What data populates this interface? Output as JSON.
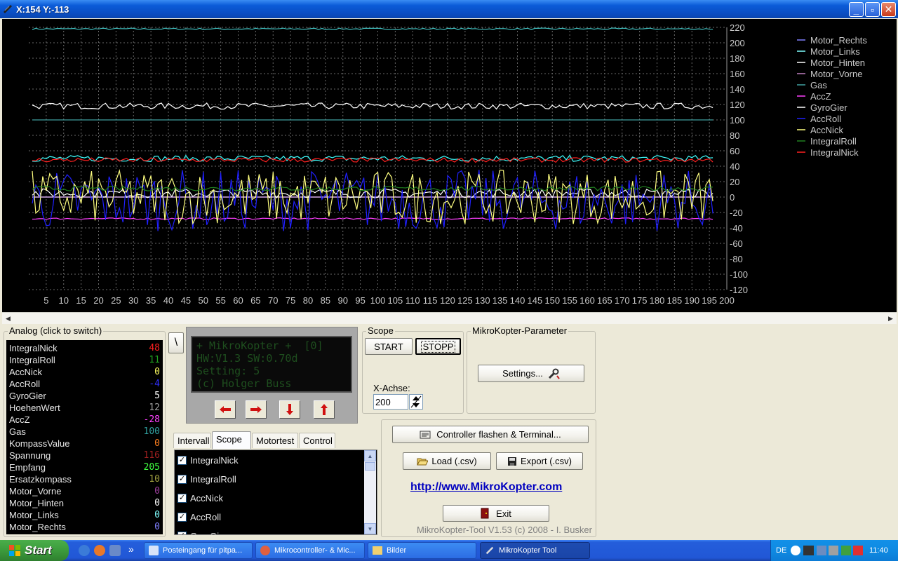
{
  "window": {
    "title": "X:154  Y:-113",
    "buttons": {
      "minimize": "_",
      "maximize": "▫",
      "close": "✕"
    }
  },
  "chart_data": {
    "type": "line",
    "background": "#000000",
    "grid": true,
    "xlim": [
      0,
      200
    ],
    "ylim": [
      -120,
      220
    ],
    "x_ticks": [
      5,
      10,
      15,
      20,
      25,
      30,
      35,
      40,
      45,
      50,
      55,
      60,
      65,
      70,
      75,
      80,
      85,
      90,
      95,
      100,
      105,
      110,
      115,
      120,
      125,
      130,
      135,
      140,
      145,
      150,
      155,
      160,
      165,
      170,
      175,
      180,
      185,
      190,
      195,
      200
    ],
    "y_ticks": [
      220,
      200,
      180,
      160,
      140,
      120,
      100,
      80,
      60,
      40,
      20,
      0,
      -20,
      -40,
      -60,
      -80,
      -100,
      -120
    ],
    "legend_position": "top-right",
    "series": [
      {
        "name": "Motor_Rechts",
        "color": "#8080FF",
        "level": 0,
        "noise": 0
      },
      {
        "name": "Motor_Links",
        "color": "#80FFFF",
        "level": 0,
        "noise": 0
      },
      {
        "name": "Motor_Hinten",
        "color": "#FFFFFF",
        "level": 0,
        "noise": 0
      },
      {
        "name": "Motor_Vorne",
        "color": "#C080C0",
        "level": 0,
        "noise": 0
      },
      {
        "name": "Gas",
        "color": "#40A0A0",
        "level": 100,
        "noise": 0
      },
      {
        "name": "AccZ",
        "color": "#FF40FF",
        "level": -28,
        "noise": 1
      },
      {
        "name": "GyroGier",
        "color": "#FFFFFF",
        "level": 5,
        "noise": 6
      },
      {
        "name": "AccRoll",
        "color": "#2020FF",
        "level": -4,
        "noise": 40
      },
      {
        "name": "AccNick",
        "color": "#FFFF80",
        "level": 0,
        "noise": 35
      },
      {
        "name": "IntegralRoll",
        "color": "#208020",
        "level": 11,
        "noise": 3
      },
      {
        "name": "IntegralNick",
        "color": "#FF2020",
        "level": 48,
        "noise": 3
      }
    ],
    "extra_series": [
      {
        "name": "",
        "color": "#40C0C0",
        "level": 218,
        "noise": 1
      },
      {
        "name": "",
        "color": "#FFFFFF",
        "level": 118,
        "noise": 4
      },
      {
        "name": "",
        "color": "#40FFFF",
        "level": 50,
        "noise": 4
      }
    ]
  },
  "analog": {
    "label": "Analog (click to switch)",
    "rows": [
      {
        "name": "IntegralNick",
        "value": "48",
        "color": "#FF2020"
      },
      {
        "name": "IntegralRoll",
        "value": "11",
        "color": "#20A020"
      },
      {
        "name": "AccNick",
        "value": "0",
        "color": "#FFFF60"
      },
      {
        "name": "AccRoll",
        "value": "-4",
        "color": "#3030FF"
      },
      {
        "name": "GyroGier",
        "value": "5",
        "color": "#FFFFFF"
      },
      {
        "name": "HoehenWert",
        "value": "12",
        "color": "#A0A0A0"
      },
      {
        "name": "AccZ",
        "value": "-28",
        "color": "#FF40FF"
      },
      {
        "name": "Gas",
        "value": "100",
        "color": "#30A0A0"
      },
      {
        "name": "KompassValue",
        "value": "0",
        "color": "#FF8020"
      },
      {
        "name": "Spannung",
        "value": "116",
        "color": "#A02020"
      },
      {
        "name": "Empfang",
        "value": "205",
        "color": "#40FF40"
      },
      {
        "name": "Ersatzkompass",
        "value": "10",
        "color": "#A0A040"
      },
      {
        "name": "Motor_Vorne",
        "value": "0",
        "color": "#A040A0"
      },
      {
        "name": "Motor_Hinten",
        "value": "0",
        "color": "#FFFFFF"
      },
      {
        "name": "Motor_Links",
        "value": "0",
        "color": "#80FFFF"
      },
      {
        "name": "Motor_Rechts",
        "value": "0",
        "color": "#8080FF"
      }
    ]
  },
  "side_button": "\\",
  "lcd": {
    "lines": [
      "+ MikroKopter +  [0]",
      "HW:V1.3 SW:0.70d",
      "Setting: 5",
      "(c) Holger Buss"
    ]
  },
  "scope": {
    "label": "Scope",
    "start": "START",
    "stopp": "STOPP",
    "x_achse_label": "X-Achse:",
    "x_achse_value": "200"
  },
  "params": {
    "label": "MikroKopter-Parameter",
    "settings": "Settings..."
  },
  "tabs": [
    "Intervall",
    "Scope",
    "Motortest",
    "Control"
  ],
  "checklist": [
    "IntegralNick",
    "IntegralRoll",
    "AccNick",
    "AccRoll",
    "GyroGier"
  ],
  "actions": {
    "flash": "Controller flashen & Terminal...",
    "load": "Load (.csv)",
    "export": "Export (.csv)",
    "link": "http://www.MikroKopter.com",
    "exit": "Exit",
    "version": "MikroKopter-Tool V1.53 (c) 2008 - I. Busker"
  },
  "taskbar": {
    "start": "Start",
    "quicklaunch_more": "»",
    "tasks": [
      "Posteingang für pitpa...",
      "Mikrocontroller- & Mic...",
      "Bilder",
      "MikroKopter Tool"
    ],
    "language": "DE",
    "clock": "11:40"
  }
}
